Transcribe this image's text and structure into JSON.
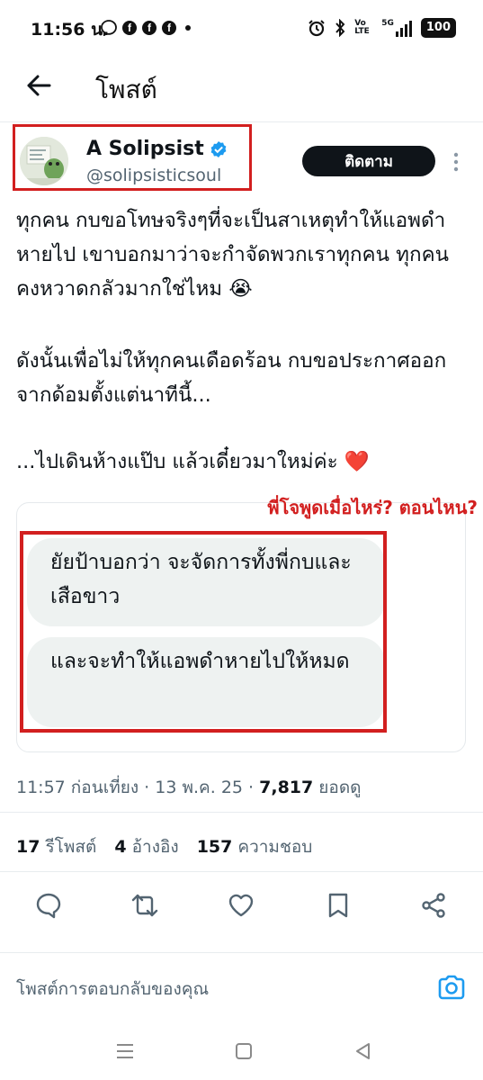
{
  "status_bar": {
    "time": "11:56 น.",
    "battery": "100",
    "network": "5G",
    "volte": "Vo LTE"
  },
  "header": {
    "title": "โพสต์"
  },
  "author": {
    "name": "A Solipsist",
    "handle": "@solipsisticsoul",
    "follow_label": "ติดตาม"
  },
  "post": {
    "paragraph1": "ทุกคน กบขอโทษจริงๆที่จะเป็นสาเหตุทำให้แอพดำหายไป เขาบอกมาว่าจะกำจัดพวกเราทุกคน ทุกคนคงหวาดกลัวมากใช่ไหม 😭",
    "paragraph2": "ดังนั้นเพื่อไม่ให้ทุกคนเดือดร้อน กบขอประกาศออกจากด้อมตั้งแต่นาทีนี้...",
    "paragraph3": "...ไปเดินห้างแป๊บ แล้วเดี๋ยวมาใหม่ค่ะ ❤️",
    "annotation": "พี่โจพูดเมื่อไหร่? ตอนไหน?",
    "bubble1": "ยัยป้าบอกว่า จะจัดการทั้งพี่กบและเสือขาว",
    "bubble2": "และจะทำให้แอพดำหายไปให้หมด"
  },
  "meta": {
    "time": "11:57 ก่อนเที่ยง",
    "date": "13 พ.ค. 25",
    "views_count": "7,817",
    "views_label": "ยอดดู"
  },
  "stats": {
    "reposts_count": "17",
    "reposts_label": "รีโพสต์",
    "quotes_count": "4",
    "quotes_label": "อ้างอิง",
    "likes_count": "157",
    "likes_label": "ความชอบ"
  },
  "reply": {
    "placeholder": "โพสต์การตอบกลับของคุณ"
  },
  "colors": {
    "accent": "#1d9bf0",
    "annotation": "#d21f1f",
    "follow_bg": "#0f1419"
  }
}
